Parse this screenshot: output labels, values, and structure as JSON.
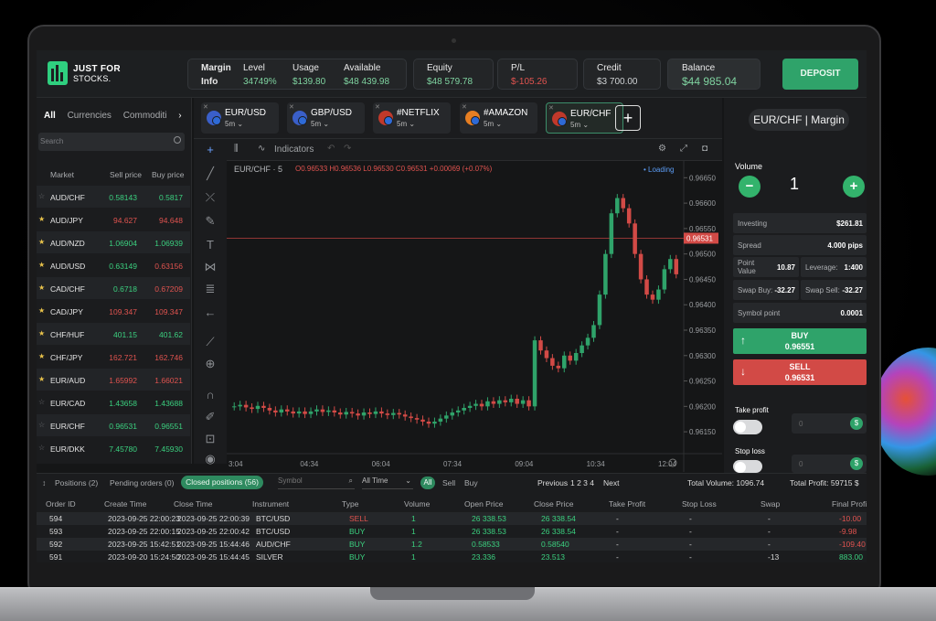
{
  "header": {
    "logo_line1": "JUST FOR",
    "logo_line2": "STOCKS.",
    "margin_label": "Margin",
    "info_label": "Info",
    "level_label": "Level",
    "level_value": "34749%",
    "usage_label": "Usage",
    "usage_value": "$139.80",
    "available_label": "Available",
    "available_value": "$48 439.98",
    "equity_label": "Equity",
    "equity_value": "$48 579.78",
    "pl_label": "P/L",
    "pl_value": "$-105.26",
    "credit_label": "Credit",
    "credit_value": "$3 700.00",
    "balance_label": "Balance",
    "balance_value": "$44 985.04",
    "deposit_label": "DEPOSIT"
  },
  "market": {
    "tabs": [
      "All",
      "Currencies",
      "Commoditi"
    ],
    "search_placeholder": "Search",
    "col_market": "Market",
    "col_sell": "Sell price",
    "col_buy": "Buy price",
    "rows": [
      {
        "name": "AUD/CHF",
        "sell": "0.58143",
        "buy": "0.5817",
        "dir": "green",
        "fav": false
      },
      {
        "name": "AUD/JPY",
        "sell": "94.627",
        "buy": "94.648",
        "dir": "red",
        "fav": true
      },
      {
        "name": "AUD/NZD",
        "sell": "1.06904",
        "buy": "1.06939",
        "dir": "green",
        "fav": true
      },
      {
        "name": "AUD/USD",
        "sell": "0.63149",
        "buy": "0.63156",
        "dir": "mixed",
        "fav": true
      },
      {
        "name": "CAD/CHF",
        "sell": "0.6718",
        "buy": "0.67209",
        "dir": "mixed",
        "fav": true
      },
      {
        "name": "CAD/JPY",
        "sell": "109.347",
        "buy": "109.347",
        "dir": "red",
        "fav": true
      },
      {
        "name": "CHF/HUF",
        "sell": "401.15",
        "buy": "401.62",
        "dir": "green",
        "fav": true
      },
      {
        "name": "CHF/JPY",
        "sell": "162.721",
        "buy": "162.746",
        "dir": "red",
        "fav": true
      },
      {
        "name": "EUR/AUD",
        "sell": "1.65992",
        "buy": "1.66021",
        "dir": "red",
        "fav": true
      },
      {
        "name": "EUR/CAD",
        "sell": "1.43658",
        "buy": "1.43688",
        "dir": "green",
        "fav": false
      },
      {
        "name": "EUR/CHF",
        "sell": "0.96531",
        "buy": "0.96551",
        "dir": "green",
        "fav": false
      },
      {
        "name": "EUR/DKK",
        "sell": "7.45780",
        "buy": "7.45930",
        "dir": "green",
        "fav": false
      }
    ]
  },
  "instrument_tabs": [
    {
      "name": "EUR/USD",
      "tf": "5m"
    },
    {
      "name": "GBP/USD",
      "tf": "5m"
    },
    {
      "name": "#NETFLIX",
      "tf": "5m"
    },
    {
      "name": "#AMAZON",
      "tf": "5m"
    },
    {
      "name": "EUR/CHF",
      "tf": "5m"
    }
  ],
  "chart_toolbar": {
    "indicators": "Indicators"
  },
  "chart_data": {
    "type": "candlestick",
    "title": "EUR/CHF · 5",
    "ohlc_line": "O0.96533 H0.96536 L0.96530 C0.96531 +0.00069 (+0.07%)",
    "status": "Loading",
    "current_price": "0.96531",
    "y_ticks": [
      "0.96650",
      "0.96600",
      "0.96550",
      "0.96500",
      "0.96450",
      "0.96400",
      "0.96350",
      "0.96300",
      "0.96250",
      "0.96200",
      "0.96150"
    ],
    "ylim": [
      0.96125,
      0.96665
    ],
    "x_ticks": [
      "3:04",
      "04:34",
      "06:04",
      "07:34",
      "09:04",
      "10:34",
      "12:04"
    ],
    "candles": [
      0.962,
      0.96203,
      0.96198,
      0.96195,
      0.96201,
      0.96197,
      0.96192,
      0.96188,
      0.96194,
      0.9619,
      0.96186,
      0.9619,
      0.96185,
      0.9619,
      0.96194,
      0.96189,
      0.96192,
      0.96188,
      0.96184,
      0.96189,
      0.96186,
      0.96182,
      0.96188,
      0.96185,
      0.9619,
      0.96186,
      0.96183,
      0.96187,
      0.96184,
      0.9618,
      0.96177,
      0.96174,
      0.9617,
      0.96166,
      0.9617,
      0.96176,
      0.96182,
      0.96188,
      0.96192,
      0.96197,
      0.96201,
      0.96205,
      0.962,
      0.9621,
      0.96205,
      0.96212,
      0.96208,
      0.96215,
      0.96205,
      0.96212,
      0.962,
      0.9633,
      0.9631,
      0.96295,
      0.9628,
      0.96275,
      0.963,
      0.9629,
      0.96305,
      0.9632,
      0.96335,
      0.9636,
      0.9642,
      0.965,
      0.9658,
      0.9661,
      0.9659,
      0.9656,
      0.965,
      0.9645,
      0.9642,
      0.9641,
      0.9643,
      0.9647,
      0.9649,
      0.9646
    ]
  },
  "order_panel": {
    "pair_title": "EUR/CHF | Margin",
    "volume_label": "Volume",
    "volume_value": "1",
    "investing_label": "Investing",
    "investing_value": "$261.81",
    "spread_label": "Spread",
    "spread_value": "4.000 pips",
    "point_value_label": "Point Value",
    "point_value_value": "10.87",
    "leverage_label": "Leverage:",
    "leverage_value": "1:400",
    "swap_buy_label": "Swap Buy:",
    "swap_buy_value": "-32.27",
    "swap_sell_label": "Swap Sell:",
    "swap_sell_value": "-32.27",
    "symbol_point_label": "Symbol point",
    "symbol_point_value": "0.0001",
    "buy_label": "BUY",
    "buy_price": "0.96551",
    "sell_label": "SELL",
    "sell_price": "0.96531",
    "take_profit_label": "Take profit",
    "stop_loss_label": "Stop loss",
    "tp_value": "0",
    "sl_value": "0"
  },
  "bottom": {
    "positions_tab": "Positions (2)",
    "pending_tab": "Pending orders (0)",
    "closed_tab": "Closed positions (56)",
    "symbol_placeholder": "Symbol",
    "time_filter": "All Time",
    "filter_all": "All",
    "filter_sell": "Sell",
    "filter_buy": "Buy",
    "previous_label": "Previous",
    "pages": "1 2 3 4",
    "next_label": "Next",
    "total_volume": "Total Volume: 1096.74",
    "total_profit": "Total Profit: 59715 $",
    "columns": [
      "Order ID",
      "Create Time",
      "Close Time",
      "Instrument",
      "Type",
      "Volume",
      "Open Price",
      "Close Price",
      "Take Profit",
      "Stop Loss",
      "Swap",
      "Final Profit $"
    ],
    "rows": [
      {
        "id": "594",
        "create": "2023-09-25 22:00:23",
        "close": "2023-09-25 22:00:39",
        "inst": "BTC/USD",
        "type": "SELL",
        "vol": "1",
        "open": "26 338.53",
        "closep": "26 338.54",
        "tp": "-",
        "sl": "-",
        "swap": "-",
        "profit": "-10.00"
      },
      {
        "id": "593",
        "create": "2023-09-25 22:00:15",
        "close": "2023-09-25 22:00:42",
        "inst": "BTC/USD",
        "type": "BUY",
        "vol": "1",
        "open": "26 338.53",
        "closep": "26 338.54",
        "tp": "-",
        "sl": "-",
        "swap": "-",
        "profit": "-9.98"
      },
      {
        "id": "592",
        "create": "2023-09-25 15:42:51",
        "close": "2023-09-25 15:44:46",
        "inst": "AUD/CHF",
        "type": "BUY",
        "vol": "1.2",
        "open": "0.58533",
        "closep": "0.58540",
        "tp": "-",
        "sl": "-",
        "swap": "-",
        "profit": "-109.40"
      },
      {
        "id": "591",
        "create": "2023-09-20 15:24:50",
        "close": "2023-09-25 15:44:45",
        "inst": "SILVER",
        "type": "BUY",
        "vol": "1",
        "open": "23.336",
        "closep": "23.513",
        "tp": "-",
        "sl": "-",
        "swap": "-13",
        "profit": "883.00"
      }
    ]
  }
}
